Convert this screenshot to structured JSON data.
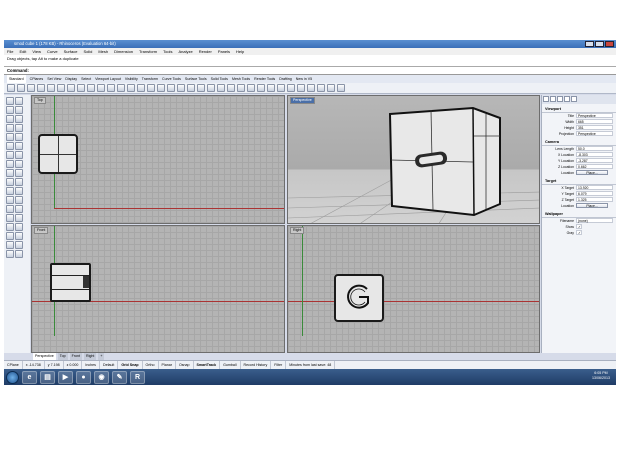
{
  "window": {
    "title": "smod cube 1 (178 KB) - Rhinoceros (Evaluation 64-bit)"
  },
  "menu": [
    "File",
    "Edit",
    "View",
    "Curve",
    "Surface",
    "Solid",
    "Mesh",
    "Dimension",
    "Transform",
    "Tools",
    "Analyze",
    "Render",
    "Panels",
    "Help"
  ],
  "command_history": "Drag objects, tap Alt to make a duplicate",
  "command_prompt": "Command:",
  "toolbar_tabs": [
    "Standard",
    "CPlanes",
    "Set View",
    "Display",
    "Select",
    "Viewport Layout",
    "Visibility",
    "Transform",
    "Curve Tools",
    "Surface Tools",
    "Solid Tools",
    "Mesh Tools",
    "Render Tools",
    "Drafting",
    "New in V5"
  ],
  "viewports": {
    "top": "Top",
    "perspective": "Perspective",
    "front": "Front",
    "right": "Right"
  },
  "viewport_tabs": [
    "Perspective",
    "Top",
    "Front",
    "Right"
  ],
  "properties": {
    "viewport_header": "Viewport",
    "viewport": [
      {
        "k": "Title",
        "v": "Perspective"
      },
      {
        "k": "Width",
        "v": "665"
      },
      {
        "k": "Height",
        "v": "351"
      },
      {
        "k": "Projection",
        "v": "Perspective"
      }
    ],
    "camera_header": "Camera",
    "camera": [
      {
        "k": "Lens Length",
        "v": "50.0"
      },
      {
        "k": "X Location",
        "v": "-8.303"
      },
      {
        "k": "Y Location",
        "v": "-3.287"
      },
      {
        "k": "Z Location",
        "v": "0.662"
      }
    ],
    "camera_place": {
      "k": "Location",
      "v": "Place..."
    },
    "target_header": "Target",
    "target": [
      {
        "k": "X Target",
        "v": "13.920"
      },
      {
        "k": "Y Target",
        "v": "6.079"
      },
      {
        "k": "Z Target",
        "v": "1.325"
      }
    ],
    "target_place": {
      "k": "Location",
      "v": "Place..."
    },
    "wallpaper_header": "Wallpaper",
    "wallpaper": [
      {
        "k": "Filename",
        "v": "(none)"
      },
      {
        "k": "Show",
        "v": "✓"
      },
      {
        "k": "Gray",
        "v": "✓"
      }
    ]
  },
  "status": {
    "cplane": "CPlane",
    "x": "x -14.738",
    "y": "y 7.198",
    "z": "z 0.000",
    "units": "Inches",
    "layer": "Default",
    "grid_snap": "Grid Snap",
    "ortho": "Ortho",
    "planar": "Planar",
    "osnap": "Osnap",
    "smarttrack": "SmartTrack",
    "gumball": "Gumball",
    "record_history": "Record History",
    "filter": "Filter",
    "message": "Minutes from last save: 48"
  },
  "taskbar": {
    "time": "6:05 PM",
    "date": "13/06/2013"
  },
  "colors": {
    "accent": "#4a6fa8",
    "viewport_bg": "#b4b4b4",
    "x_axis": "#a33333",
    "y_axis": "#3a8a3a"
  }
}
